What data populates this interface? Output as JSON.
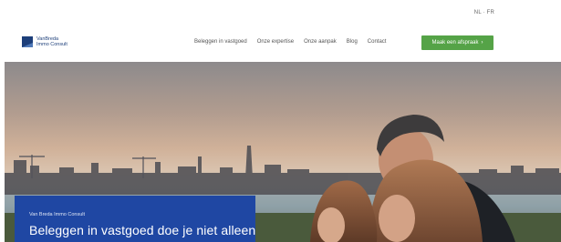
{
  "language_switch": {
    "nl": "NL",
    "separator": " · ",
    "fr": "FR"
  },
  "logo": {
    "line1": "VanBreda",
    "line2": "Immo Consult",
    "icon": "logo-mark"
  },
  "nav": {
    "items": [
      {
        "label": "Beleggen in vastgoed"
      },
      {
        "label": "Onze expertise"
      },
      {
        "label": "Onze aanpak"
      },
      {
        "label": "Blog"
      },
      {
        "label": "Contact"
      }
    ],
    "cta_label": "Maak een afspraak",
    "cta_icon": "chevron-right-icon",
    "cta_color": "#55a347"
  },
  "hero": {
    "image": "city-skyline-with-family-photo",
    "eyebrow": "Van Breda Immo Consult",
    "title": "Beleggen in vastgoed doe je niet alleen",
    "box_color": "#1f47a3"
  }
}
